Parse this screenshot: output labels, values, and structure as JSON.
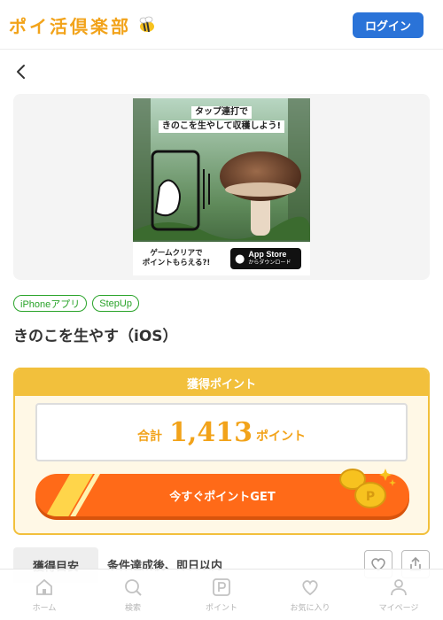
{
  "header": {
    "logo_text": "ポイ活倶楽部",
    "login_label": "ログイン",
    "accent_color": "#2a73d8"
  },
  "banner": {
    "line1": "タップ連打で",
    "line2": "きのこを生やして収穫しよう!",
    "cta_text_1": "ゲームクリアで",
    "cta_text_2": "ポイントもらえる?!",
    "appstore_main": "App Store",
    "appstore_sub": "からダウンロード"
  },
  "tags": [
    "iPhoneアプリ",
    "StepUp"
  ],
  "offer": {
    "title": "きのこを生やす（iOS）"
  },
  "points": {
    "header": "獲得ポイント",
    "total_label": "合計",
    "total_value": "1,413",
    "total_unit": "ポイント",
    "cta_label": "今すぐポイントGET",
    "accent_color": "#f2c03c",
    "button_color": "#ff6a18"
  },
  "info": {
    "label": "獲得目安",
    "value": "条件達成後、即日以内"
  },
  "nav": [
    {
      "label": "ホーム",
      "icon": "home-icon"
    },
    {
      "label": "検索",
      "icon": "search-icon"
    },
    {
      "label": "ポイント",
      "icon": "point-icon"
    },
    {
      "label": "お気に入り",
      "icon": "heart-icon"
    },
    {
      "label": "マイページ",
      "icon": "user-icon"
    }
  ]
}
